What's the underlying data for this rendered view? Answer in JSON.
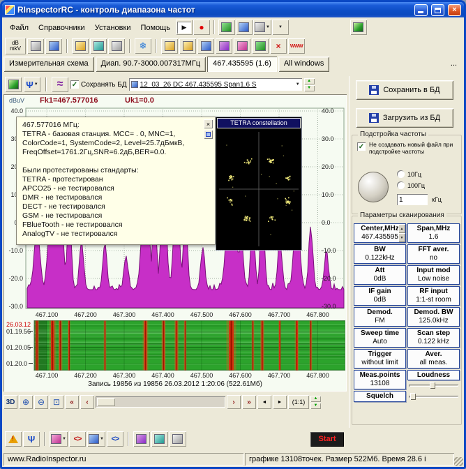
{
  "window": {
    "title": "RInspectorRC - контроль диапазона частот"
  },
  "menubar": {
    "items": [
      "Файл",
      "Справочники",
      "Установки",
      "Помощь"
    ]
  },
  "toolbar": {
    "db_top": "dB",
    "db_bottom": "mkV",
    "www": "WWW"
  },
  "tabs": {
    "items": [
      "Измерительная схема",
      "Диап. 90.7-3000.007317МГц",
      "467.435595 (1.6)",
      "All windows"
    ],
    "active_index": 2,
    "more": "..."
  },
  "minibar": {
    "save_db_label": "Сохранять БД",
    "record_name": "12_03_26 DC 467.435595 Span1.6 S"
  },
  "readout": {
    "unit": "dBuV",
    "fk": "Fk1=467.577016",
    "uk": "Uk1=0.0"
  },
  "spectrum": {
    "y_labels": [
      "40.0",
      "30.0",
      "20.0",
      "10.0",
      "0.0",
      "-10.0",
      "-20.0",
      "-30.0"
    ],
    "x_labels": [
      "467.100",
      "467.200",
      "467.300",
      "467.400",
      "467.500",
      "467.600",
      "467.700",
      "467.800"
    ],
    "floor_db": -24,
    "peaks": [
      [
        467.075,
        -2,
        4
      ],
      [
        467.115,
        16,
        5
      ],
      [
        467.135,
        8,
        4
      ],
      [
        467.158,
        3,
        3
      ],
      [
        467.19,
        -7,
        3
      ],
      [
        467.25,
        -8,
        3
      ],
      [
        467.305,
        -12,
        3
      ],
      [
        467.355,
        14,
        5
      ],
      [
        467.378,
        6,
        3
      ],
      [
        467.402,
        12,
        4
      ],
      [
        467.435,
        10,
        4
      ],
      [
        467.458,
        2,
        3
      ],
      [
        467.503,
        -10,
        3
      ],
      [
        467.577,
        20,
        6
      ],
      [
        467.602,
        -4,
        3
      ],
      [
        467.632,
        0,
        3
      ],
      [
        467.657,
        5,
        3
      ],
      [
        467.702,
        -6,
        3
      ],
      [
        467.746,
        7,
        4
      ],
      [
        467.782,
        -2,
        3
      ],
      [
        467.822,
        -10,
        3
      ]
    ]
  },
  "popup": {
    "lines": [
      "467.577016 МГц:",
      "TETRA - базовая станция. MCC= . 0, MNC=1,",
      "ColorCode=1, SystemCode=2, Level=25.7дБмкВ,",
      "FreqOffset=1761.2Гц,SNR=6.2дБ,BER=0.0.",
      "",
      "Были протестированы стандарты:",
      "TETRA - протестирован",
      "APCO25 - не тестировался",
      "DMR - не тестировался",
      "DECT - не тестировался",
      "GSM - не тестировался",
      "FBlueTooth - не тестировался",
      "AnalogTV - не тестировался"
    ]
  },
  "constellation": {
    "title": "TETRA constellation"
  },
  "waterfall": {
    "date": "26.03.12",
    "times": [
      "01.19.56",
      "01.20.05",
      "01.20.0"
    ],
    "x_labels": [
      "467.100",
      "467.200",
      "467.300",
      "467.400",
      "467.500",
      "467.600",
      "467.700",
      "467.800"
    ],
    "stripes": [
      [
        467.075,
        3
      ],
      [
        467.115,
        5
      ],
      [
        467.135,
        3
      ],
      [
        467.158,
        2
      ],
      [
        467.25,
        2
      ],
      [
        467.355,
        4
      ],
      [
        467.402,
        3
      ],
      [
        467.435,
        3
      ],
      [
        467.458,
        2
      ],
      [
        467.577,
        7
      ],
      [
        467.632,
        2
      ],
      [
        467.657,
        3
      ],
      [
        467.702,
        2
      ],
      [
        467.746,
        3
      ],
      [
        467.782,
        2
      ]
    ]
  },
  "record_status": "Запись 19856  из 19856   26.03.2012 1:20:06 (522.61Мб)",
  "nav": {
    "threed": "3D",
    "one_to_one": "(1:1)"
  },
  "right_panel": {
    "save_button": "Сохранить в БД",
    "load_button": "Загрузить из БД",
    "tuning": {
      "title": "Подстройка частоты",
      "checkbox_label": "Не создавать новый файл при подстройке частоты",
      "radio_10": "10Гц",
      "radio_100": "100Гц",
      "step_value": "1",
      "step_unit": "кГц"
    },
    "scan": {
      "title": "Параметры сканирования",
      "buttons": [
        {
          "label": "Center,MHz",
          "value": "467.435595"
        },
        {
          "label": "Span,MHz",
          "value": "1.6"
        },
        {
          "label": "BW",
          "value": "0.122kHz"
        },
        {
          "label": "FFT aver.",
          "value": "no"
        },
        {
          "label": "Att",
          "value": "0dB"
        },
        {
          "label": "Input mod",
          "value": "Low noise"
        },
        {
          "label": "IF gain",
          "value": "0dB"
        },
        {
          "label": "RF input",
          "value": "1:1-st room"
        },
        {
          "label": "Demod.",
          "value": "FM"
        },
        {
          "label": "Demod. BW",
          "value": "125.0kHz"
        },
        {
          "label": "Sweep time",
          "value": "Auto"
        },
        {
          "label": "Scan step",
          "value": "0.122 kHz"
        },
        {
          "label": "Trigger",
          "value": "without limit"
        },
        {
          "label": "Aver.",
          "value": "all meas."
        },
        {
          "label": "Meas.points",
          "value": "13108"
        }
      ],
      "loudness": "Loudness",
      "squelch": "Squelch"
    }
  },
  "bottom_toolbar": {
    "start": "Start"
  },
  "statusbar": {
    "left": "www.RadioInspector.ru",
    "right": "графике 13108точек.  Размер 522Мб. Время 28.6 і"
  },
  "icons": {
    "play": "▶",
    "record": "●",
    "snowflake": "❄",
    "close_x": "×",
    "up": "▲",
    "down": "▼",
    "left": "◄",
    "right": "►",
    "dbl_left": "«",
    "dbl_right": "»",
    "sgl_left": "‹",
    "sgl_right": "›",
    "antenna": "Ψ",
    "warning_mark": "!",
    "angle_pair": "<>",
    "check": "✓",
    "dropdown": "▼",
    "zoom_in": "⊕",
    "zoom_out": "⊖",
    "zoom_sel": "⊡",
    "wave": "≈"
  }
}
